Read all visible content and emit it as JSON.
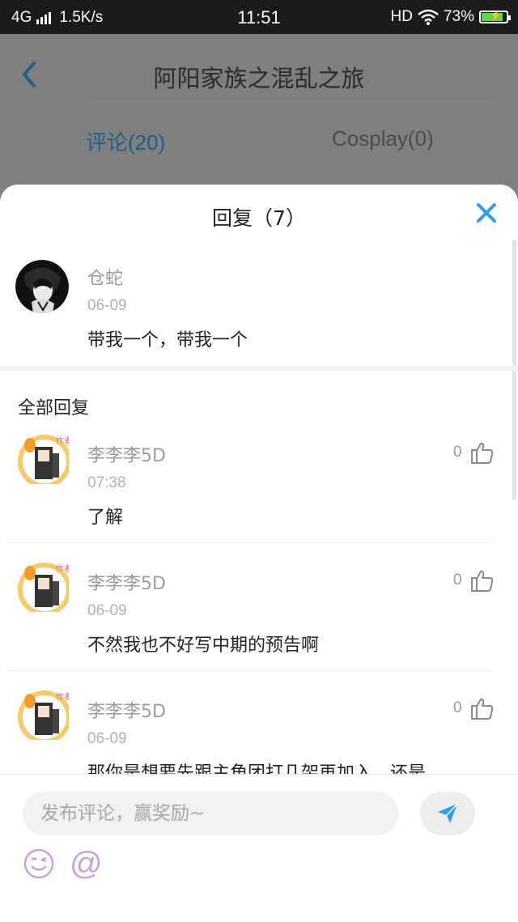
{
  "status_bar": {
    "network": "4G",
    "speed": "1.5K/s",
    "time": "11:51",
    "hd": "HD",
    "battery": "73%"
  },
  "header": {
    "title": "阿阳家族之混乱之旅",
    "tabs": [
      {
        "label": "评论(20)",
        "active": true
      },
      {
        "label": "Cosplay(0)",
        "active": false
      }
    ]
  },
  "sheet": {
    "title": "回复（7）",
    "original_comment": {
      "username": "仓蛇",
      "date": "06-09",
      "content": "带我一个，带我一个"
    },
    "section_title": "全部回复",
    "replies": [
      {
        "username": "李李李5D",
        "date": "07:38",
        "content": "了解",
        "likes": "0"
      },
      {
        "username": "李李李5D",
        "date": "06-09",
        "content": "不然我也不好写中期的预告啊",
        "likes": "0"
      },
      {
        "username": "李李李5D",
        "date": "06-09",
        "content": "那你是想要先跟主角团打几架再加入，还是",
        "likes": "0"
      }
    ]
  },
  "composer": {
    "placeholder": "发布评论，赢奖励~",
    "at_label": "@"
  },
  "colors": {
    "accent": "#2d9ee0",
    "overlay": "#7f7f7f",
    "avatar_badge": "#f6c96a"
  },
  "icons": [
    "back-icon",
    "close-icon",
    "thumbs-up-icon",
    "send-icon",
    "emoji-icon",
    "wifi-icon",
    "signal-icon",
    "battery-icon"
  ]
}
